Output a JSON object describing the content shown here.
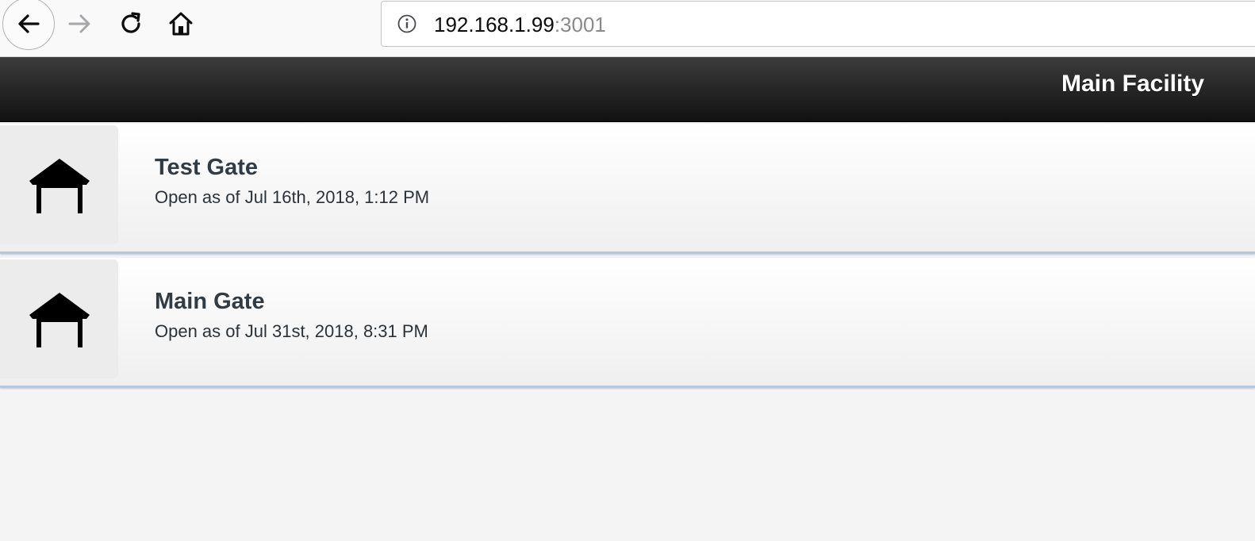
{
  "browser": {
    "url_host": "192.168.1.99",
    "url_port": ":3001",
    "icons": {
      "back": "back-arrow-icon",
      "forward": "forward-arrow-icon",
      "reload": "reload-icon",
      "home": "home-icon",
      "info": "info-icon"
    }
  },
  "header": {
    "title": "Main Facility",
    "background": "#1a1a1a"
  },
  "gates": [
    {
      "name": "Test Gate",
      "status": "Open as of Jul 16th, 2018, 1:12 PM",
      "icon": "gate-icon"
    },
    {
      "name": "Main Gate",
      "status": "Open as of Jul 31st, 2018, 8:31 PM",
      "icon": "gate-icon"
    }
  ]
}
